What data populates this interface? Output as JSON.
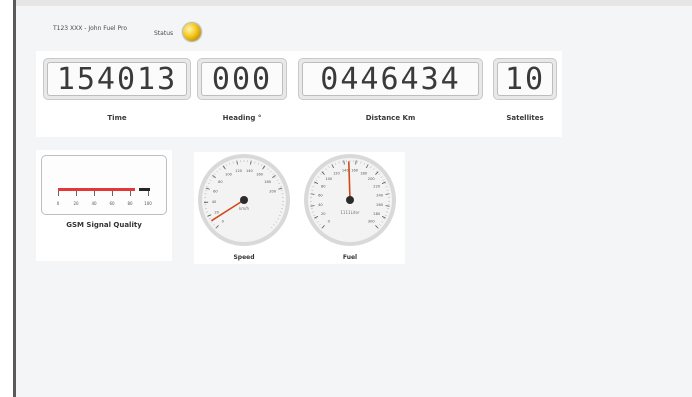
{
  "header": {
    "vehicle_title": "T123 XXX - John Fuel Pro",
    "status_label": "Status",
    "status_color": "#f5c518"
  },
  "readouts": [
    {
      "id": "time",
      "value": "154013",
      "label": "Time"
    },
    {
      "id": "heading",
      "value": "000",
      "label": "Heading °"
    },
    {
      "id": "distance",
      "value": "0446434",
      "label": "Distance Km"
    },
    {
      "id": "satellites",
      "value": "10",
      "label": "Satellites"
    }
  ],
  "gsm": {
    "label": "GSM Signal Quality",
    "scale": [
      "0",
      "20",
      "40",
      "60",
      "80",
      "100"
    ],
    "value_percent": 85,
    "bar_color": "#e23838"
  },
  "speed_gauge": {
    "label": "Speed",
    "unit": "km/h",
    "min": 0,
    "max": 260,
    "value": 12,
    "ticks": [
      "0",
      "20",
      "40",
      "60",
      "80",
      "100",
      "120",
      "140",
      "160",
      "180",
      "200"
    ],
    "needle_color": "#d24a1a"
  },
  "fuel_gauge": {
    "label": "Fuel",
    "unit": "1111Liter",
    "min": 0,
    "max": 300,
    "value": 148,
    "ticks": [
      "0",
      "20",
      "40",
      "60",
      "80",
      "100",
      "120",
      "140",
      "160",
      "180",
      "200",
      "220",
      "240",
      "260",
      "280",
      "300"
    ],
    "needle_color": "#d24a1a"
  }
}
